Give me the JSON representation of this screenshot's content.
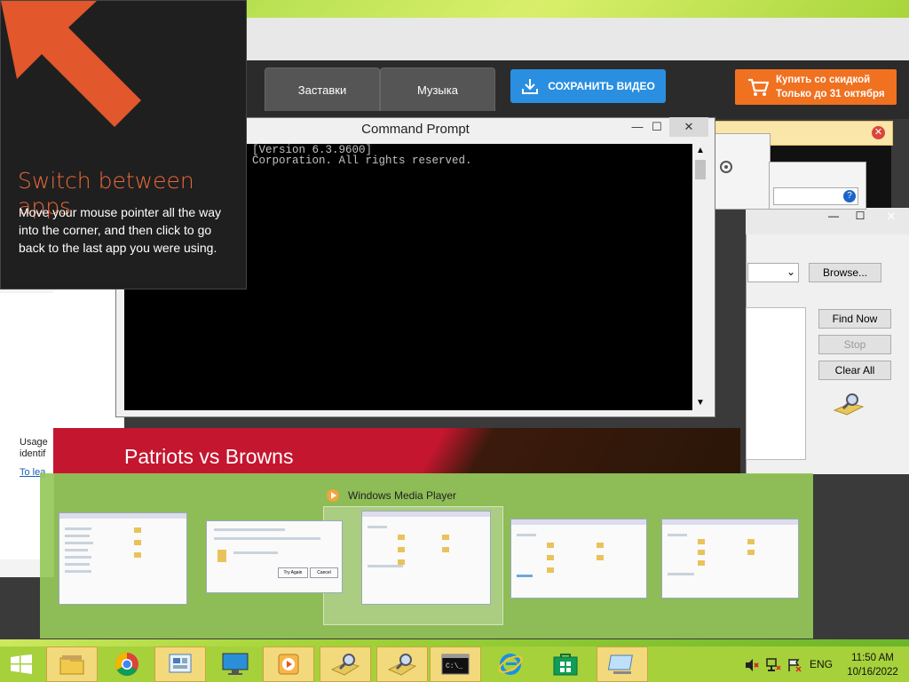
{
  "tutorial": {
    "title": "Switch between apps",
    "body": "Move your mouse pointer all the way into the corner, and then click to go back to the last app you were using."
  },
  "video_app": {
    "tabs": [
      "Заставки",
      "Музыка"
    ],
    "save_label": "СОХРАНИТЬ ВИДЕО",
    "buy_line1": "Купить со скидкой",
    "buy_line2": "Только до 31 октября"
  },
  "cmd": {
    "title": "Command Prompt",
    "line1": "[Version 6.3.9600]",
    "line2": "Corporation. All rights reserved."
  },
  "find_files": {
    "browse_label": "Browse...",
    "find_now_label": "Find Now",
    "stop_label": "Stop",
    "clear_all_label": "Clear All"
  },
  "background": {
    "sports_title": "Patriots vs Browns",
    "usage_text1": "Usage",
    "usage_text2": "identif",
    "link_text": "To lea"
  },
  "switcher": {
    "label": "Windows Media Player",
    "thumbs": [
      "explorer-window-1",
      "permission-dialog",
      "explorer-window-2",
      "explorer-window-3",
      "explorer-window-4"
    ],
    "dialog_button1": "Try Again",
    "dialog_button2": "Cancel"
  },
  "taskbar": {
    "items": [
      "file-explorer",
      "chrome",
      "control-panel",
      "computer",
      "media-player",
      "search-tool",
      "search-tool-2",
      "command-prompt",
      "internet-explorer",
      "store",
      "remote-desktop"
    ],
    "lang": "ENG",
    "time": "11:50 AM",
    "date": "10/16/2022"
  },
  "colors": {
    "accent_orange": "#e8683a",
    "taskbar": "#a6d13b",
    "switcher": "#96c85a"
  }
}
